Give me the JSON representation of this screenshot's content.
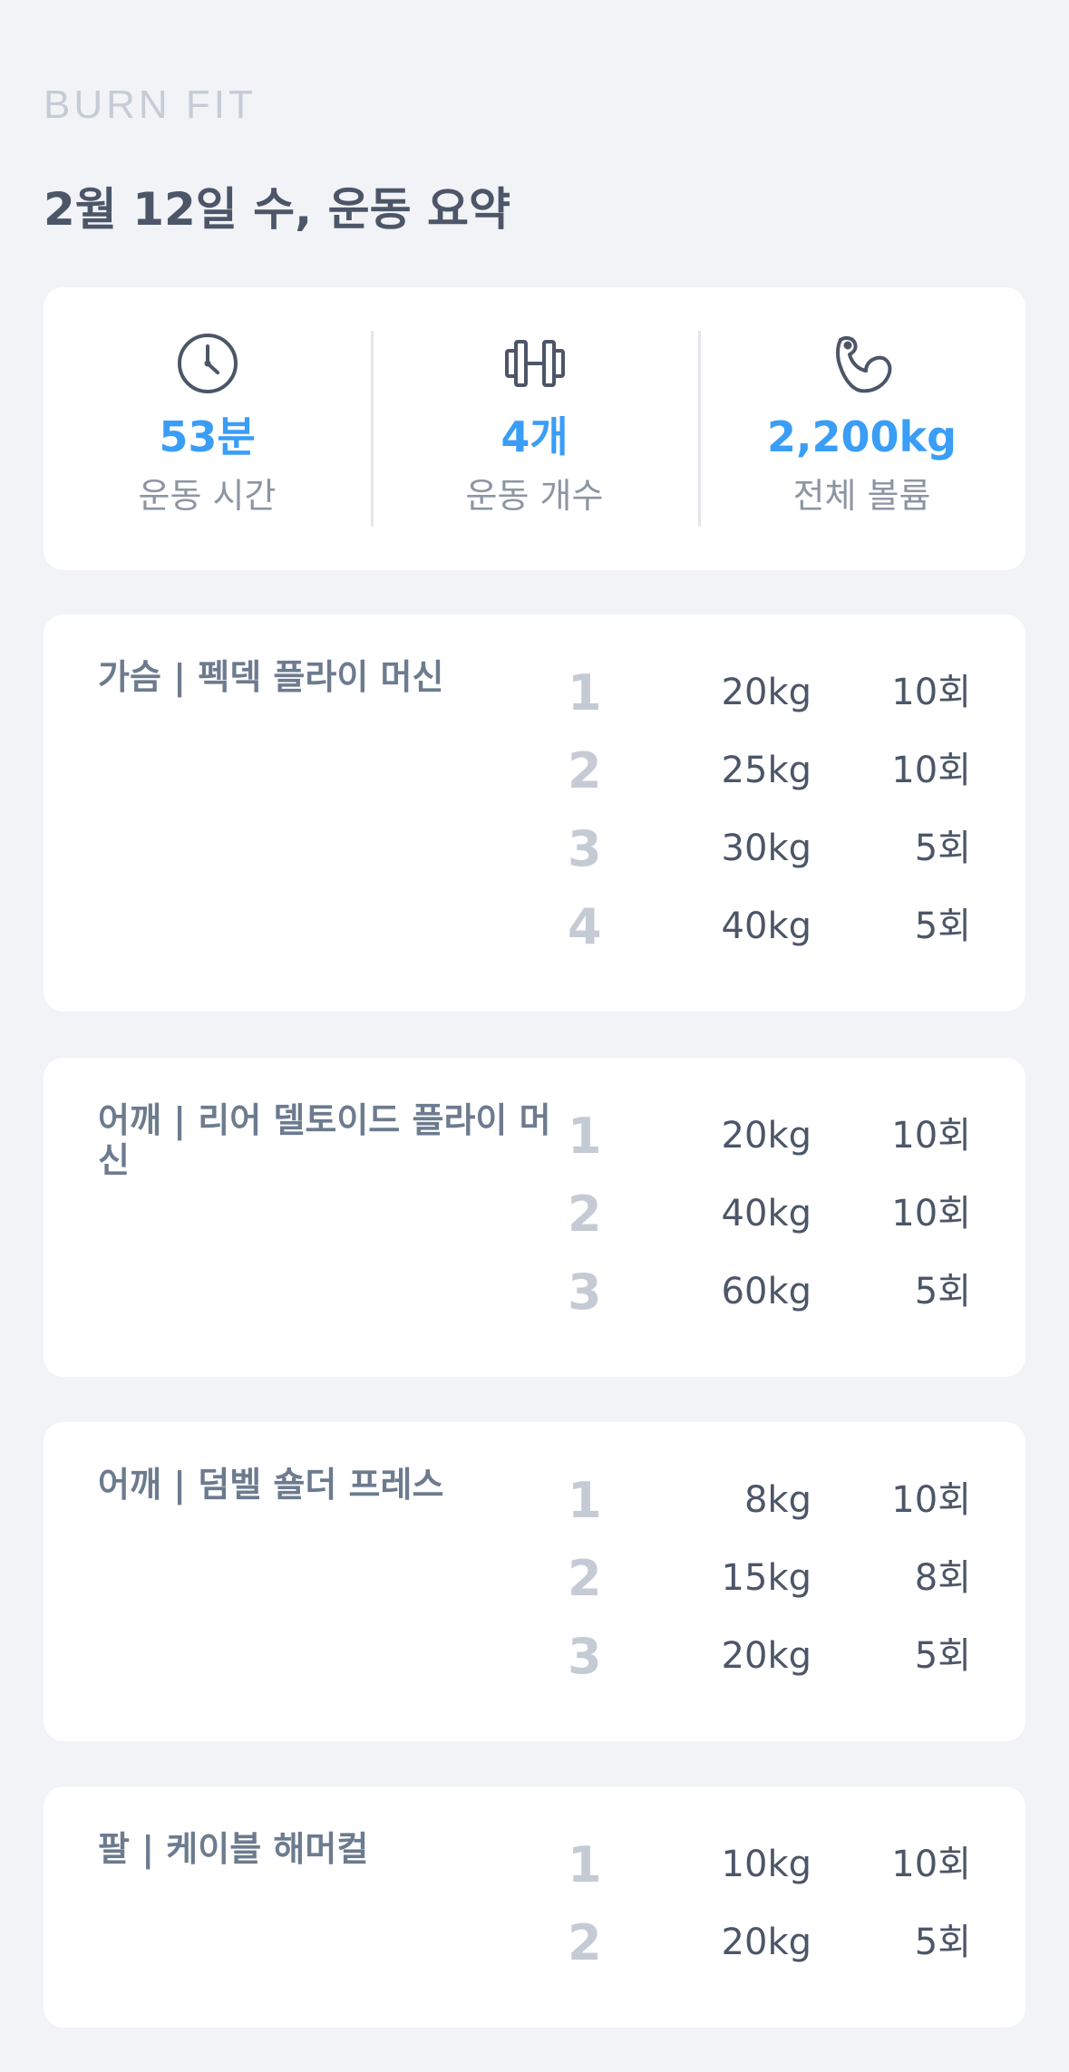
{
  "brand": "BURN FIT",
  "title": "2월 12일 수, 운동 요약",
  "summary": [
    {
      "icon": "clock-icon",
      "value": "53분",
      "label": "운동 시간"
    },
    {
      "icon": "dumbbell-icon",
      "value": "4개",
      "label": "운동 개수"
    },
    {
      "icon": "flexed-arm-icon",
      "value": "2,200kg",
      "label": "전체 볼륨"
    }
  ],
  "exercises": [
    {
      "title": "가슴 | 펙덱 플라이 머신",
      "sets": [
        {
          "num": "1",
          "weight": "20kg",
          "reps": "10회"
        },
        {
          "num": "2",
          "weight": "25kg",
          "reps": "10회"
        },
        {
          "num": "3",
          "weight": "30kg",
          "reps": "5회"
        },
        {
          "num": "4",
          "weight": "40kg",
          "reps": "5회"
        }
      ]
    },
    {
      "title": "어깨 | 리어 델토이드 플라이 머신",
      "sets": [
        {
          "num": "1",
          "weight": "20kg",
          "reps": "10회"
        },
        {
          "num": "2",
          "weight": "40kg",
          "reps": "10회"
        },
        {
          "num": "3",
          "weight": "60kg",
          "reps": "5회"
        }
      ]
    },
    {
      "title": "어깨 | 덤벨 숄더 프레스",
      "sets": [
        {
          "num": "1",
          "weight": "8kg",
          "reps": "10회"
        },
        {
          "num": "2",
          "weight": "15kg",
          "reps": "8회"
        },
        {
          "num": "3",
          "weight": "20kg",
          "reps": "5회"
        }
      ]
    },
    {
      "title": "팔 | 케이블 해머컬",
      "sets": [
        {
          "num": "1",
          "weight": "10kg",
          "reps": "10회"
        },
        {
          "num": "2",
          "weight": "20kg",
          "reps": "5회"
        }
      ]
    }
  ]
}
